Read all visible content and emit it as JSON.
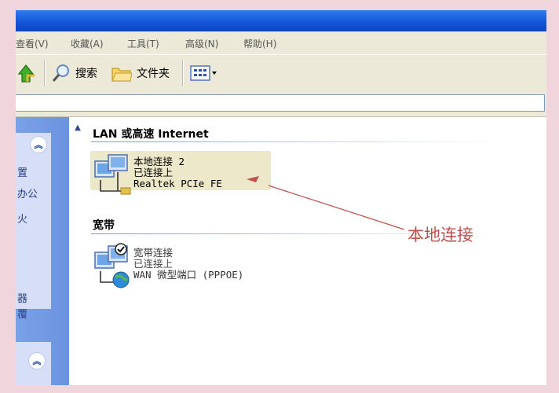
{
  "menu": {
    "items": [
      "查看(V)",
      "收藏(A)",
      "工具(T)",
      "高级(N)",
      "帮助(H)"
    ]
  },
  "toolbar": {
    "search_label": "搜索",
    "folders_label": "文件夹"
  },
  "sidebar": {
    "fragments": [
      "置",
      "办公",
      "火",
      "器",
      "覆"
    ]
  },
  "groups": {
    "lan_header": "LAN 或高速 Internet",
    "broadband_header": "宽带"
  },
  "connections": {
    "local": {
      "name": "本地连接 2",
      "status": "已连接上",
      "device": "Realtek PCIe FE"
    },
    "broadband": {
      "name": "宽带连接",
      "status": "已连接上",
      "device": "WAN 微型端口 (PPPOE)"
    }
  },
  "annotation": {
    "label": "本地连接",
    "color": "#c0504d"
  },
  "colors": {
    "titlebar": "#1556d8",
    "sidebar": "#6b93e0",
    "window_bg": "#ece9d8",
    "frame": "#f0d6dc"
  },
  "icons": [
    "back-arrow-icon",
    "search-icon",
    "folder-icon",
    "view-icon",
    "network-connection-icon",
    "broadband-globe-icon",
    "collapse-chevron-icon"
  ]
}
